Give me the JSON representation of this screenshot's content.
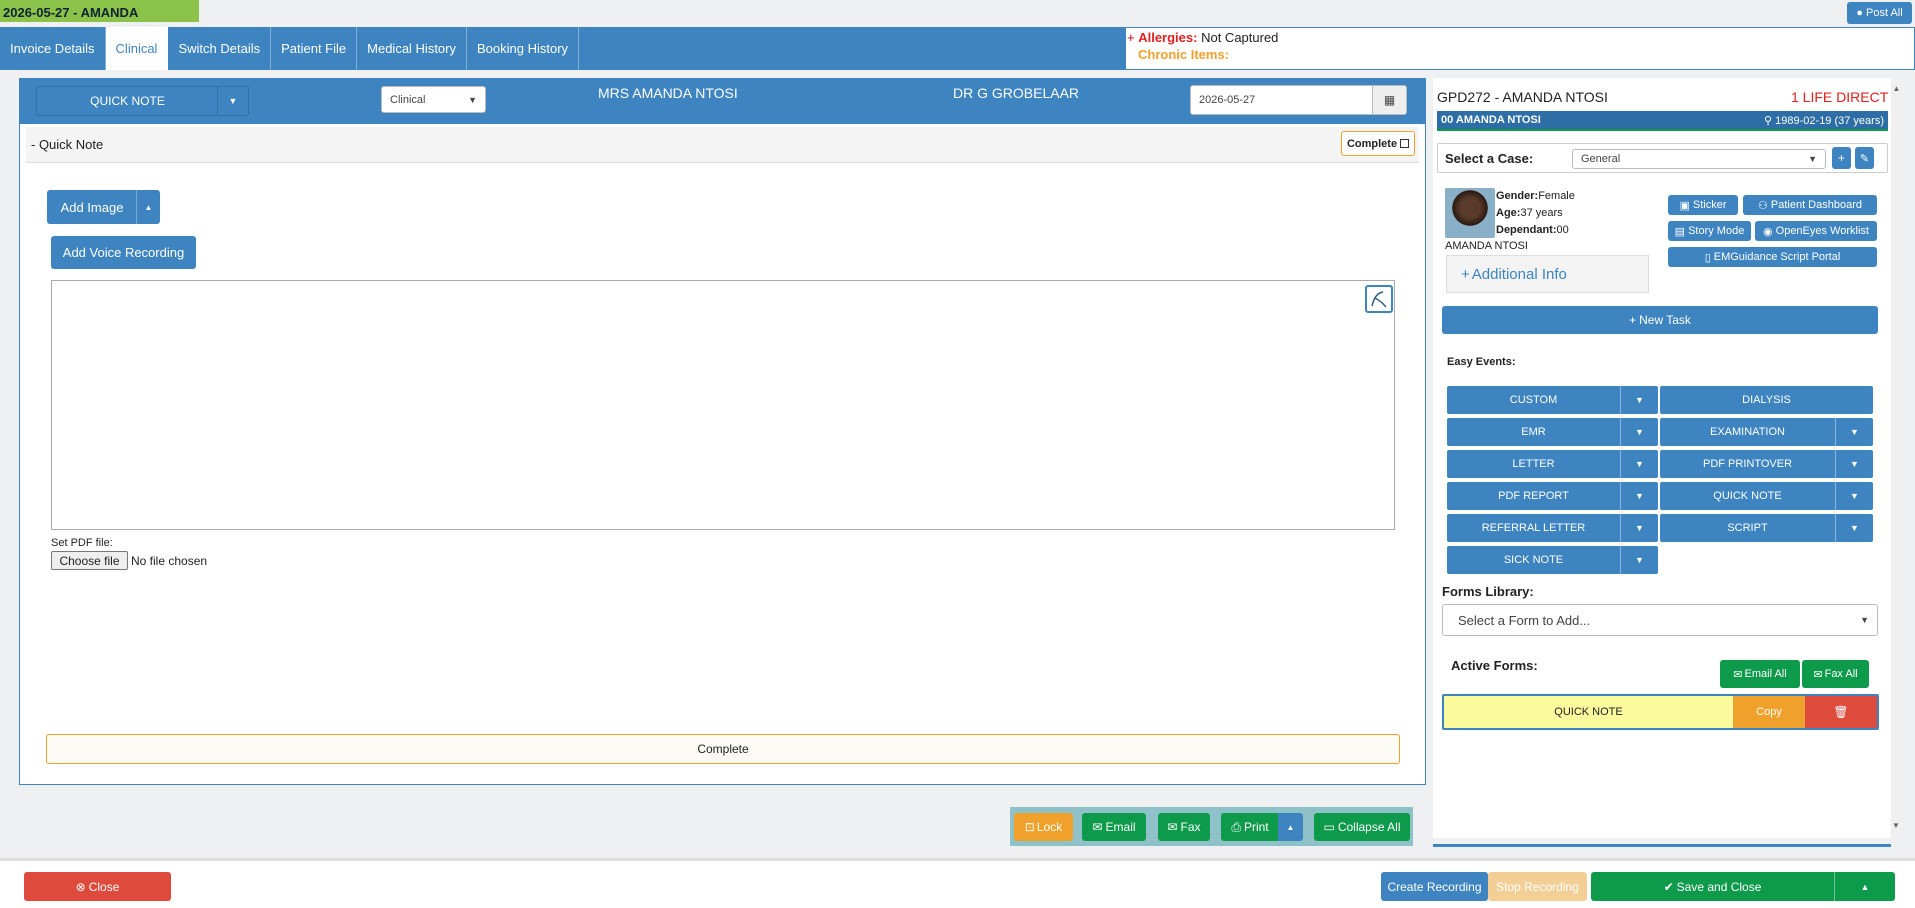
{
  "header": {
    "title": "2026-05-27 - AMANDA",
    "post_all": "Post All"
  },
  "tabs": [
    {
      "label": "Invoice Details"
    },
    {
      "label": "Clinical"
    },
    {
      "label": "Switch Details"
    },
    {
      "label": "Patient File"
    },
    {
      "label": "Medical History"
    },
    {
      "label": "Booking History"
    }
  ],
  "alerts": {
    "plus": "+",
    "allergies_label": "Allergies:",
    "allergies_value": "Not Captured",
    "chronic_label": "Chronic Items:"
  },
  "toolbar": {
    "note_type": "QUICK NOTE",
    "category": "Clinical",
    "patient": "MRS AMANDA NTOSI",
    "doctor": "DR G GROBELAAR",
    "date": "2026-05-27"
  },
  "note": {
    "title": "- Quick Note",
    "complete_label": "Complete",
    "add_image": "Add Image",
    "add_voice": "Add Voice Recording",
    "set_pdf": "Set PDF file:",
    "choose_file": "Choose file",
    "no_file": "No file chosen",
    "complete_bar": "Complete"
  },
  "bottom_actions": {
    "lock": "Lock",
    "email": "Email",
    "fax": "Fax",
    "print": "Print",
    "collapse_all": "Collapse All"
  },
  "footer": {
    "close": "Close",
    "create_recording": "Create Recording",
    "stop_recording": "Stop Recording",
    "save_close": "Save and Close"
  },
  "patient": {
    "file_id": "GPD272 - AMANDA NTOSI",
    "medical_aid": "1 LIFE DIRECT",
    "dependant_line": "00 AMANDA NTOSI",
    "dob": "1989-02-19 (37 years)",
    "select_case_label": "Select a Case:",
    "case_value": "General",
    "gender_label": "Gender:",
    "gender": "Female",
    "age_label": "Age:",
    "age": "37 years",
    "dependant_label": "Dependant:",
    "dependant": "00",
    "name": "AMANDA NTOSI",
    "additional_info": "Additional Info",
    "sticker": "Sticker",
    "dashboard": "Patient Dashboard",
    "story_mode": "Story Mode",
    "openeyes": "OpenEyes Worklist",
    "emguidance": "EMGuidance Script Portal",
    "new_task": "New Task"
  },
  "easy_events": {
    "label": "Easy Events:",
    "items": [
      "CUSTOM",
      "DIALYSIS",
      "EMR",
      "EXAMINATION",
      "LETTER",
      "PDF PRINTOVER",
      "PDF REPORT",
      "QUICK NOTE",
      "REFERRAL LETTER",
      "SCRIPT",
      "SICK NOTE"
    ]
  },
  "forms": {
    "library_label": "Forms Library:",
    "placeholder": "Select a Form to Add...",
    "active_label": "Active Forms:",
    "email_all": "Email All",
    "fax_all": "Fax All",
    "active_item": "QUICK NOTE",
    "copy": "Copy"
  },
  "colors": {
    "accent": "#3d84c0",
    "green": "#0d9a4b",
    "orange": "#efa12b",
    "red": "#de4a3c",
    "title_green": "#8bc34a"
  }
}
